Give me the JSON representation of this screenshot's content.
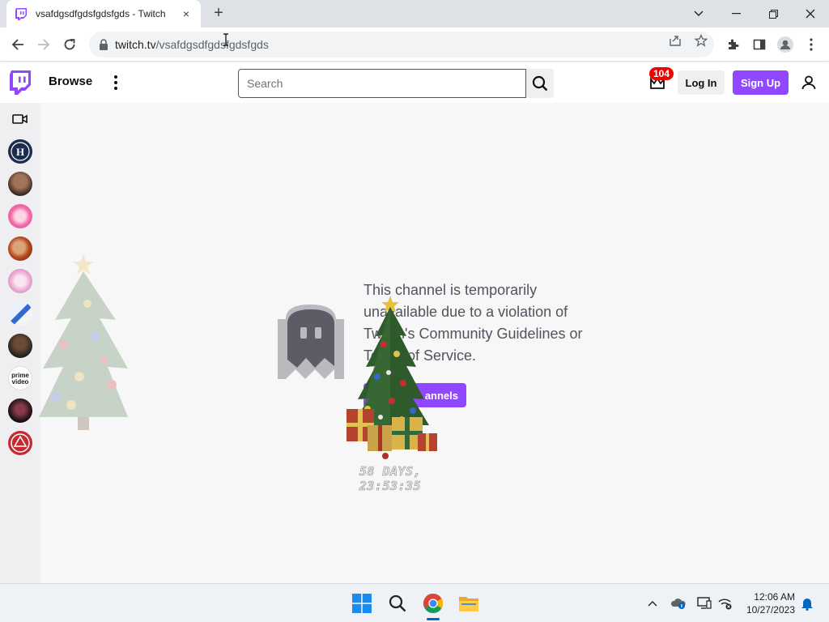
{
  "browser": {
    "tab": {
      "title": "vsafdgsdfgdsfgdsfgds - Twitch",
      "favicon": "twitch-favicon-icon",
      "close": "×"
    },
    "new_tab": "+",
    "address": {
      "host": "twitch.tv",
      "path": "/vsafdgsdfgdsfgdsfgds"
    },
    "window_controls": [
      "chevron-down-icon",
      "minimize-icon",
      "restore-icon",
      "close-icon"
    ],
    "toolbar_icons": [
      "back-icon",
      "forward-icon",
      "reload-icon",
      "share-icon",
      "star-icon",
      "extensions-icon",
      "side-panel-icon",
      "profile-icon",
      "kebab-menu-icon"
    ]
  },
  "twitch": {
    "nav": {
      "browse": "Browse",
      "search_placeholder": "Search",
      "notification_count": "104",
      "login": "Log In",
      "signup": "Sign Up"
    },
    "sidebar": {
      "avatars": [
        "channel-avatar-1",
        "channel-avatar-2",
        "channel-avatar-3",
        "channel-avatar-4",
        "channel-avatar-5",
        "channel-avatar-6",
        "channel-avatar-7",
        "channel-avatar-8",
        "channel-avatar-9",
        "channel-avatar-10"
      ],
      "prime_label_1": "prime",
      "prime_label_2": "video"
    },
    "main": {
      "message": "This channel is temporarily unavailable due to a violation of Twitch's Community Guidelines or Terms of Service.",
      "browse_button": "annels",
      "countdown": "58 DAYS, 23:53:35"
    },
    "colors": {
      "brand": "#9147ff",
      "badge": "#eb0400",
      "text": "#53535f"
    }
  },
  "taskbar": {
    "apps": [
      "windows-start-icon",
      "search-icon",
      "chrome-icon",
      "file-explorer-icon"
    ],
    "tray": [
      "chevron-up-icon",
      "onedrive-icon",
      "display-icon",
      "network-icon",
      "notification-bell-icon"
    ],
    "time": "12:06 AM",
    "date": "10/27/2023"
  }
}
